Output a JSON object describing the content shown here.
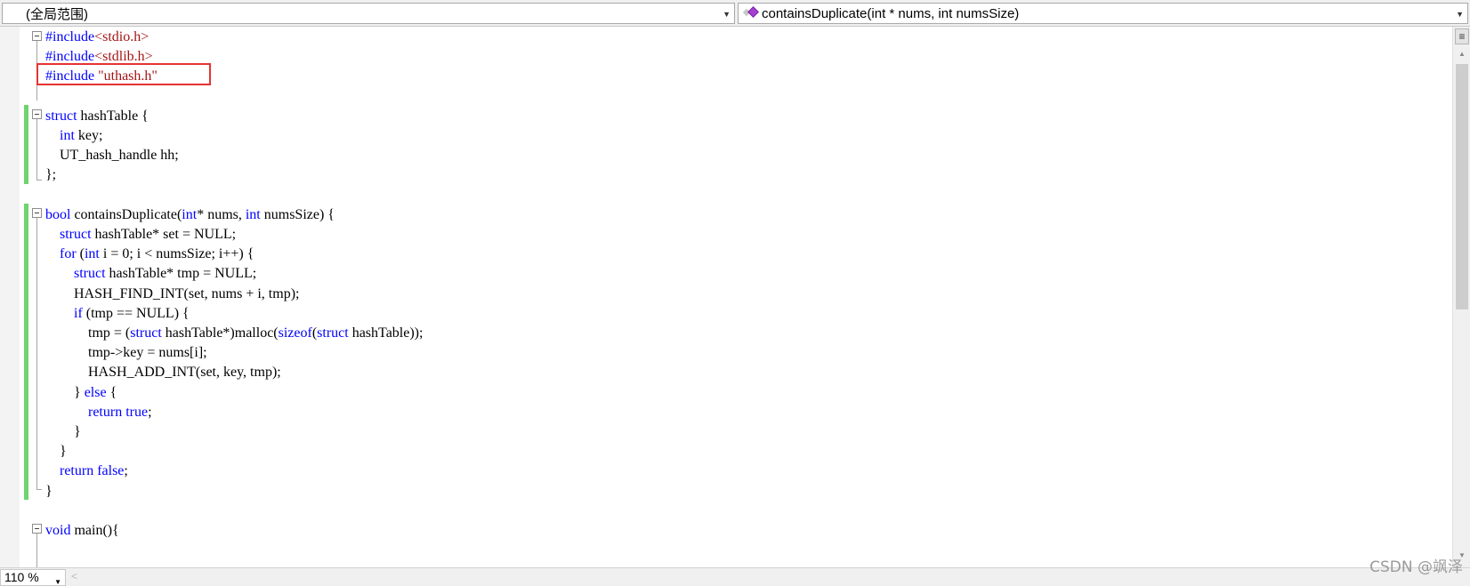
{
  "navbar": {
    "scope_label": "(全局范围)",
    "member_label": "containsDuplicate(int * nums, int numsSize)"
  },
  "code_lines": [
    [
      {
        "t": "#include",
        "c": "kw"
      },
      {
        "t": "<stdio.h>",
        "c": "str"
      }
    ],
    [
      {
        "t": "#include",
        "c": "kw"
      },
      {
        "t": "<stdlib.h>",
        "c": "str"
      }
    ],
    [
      {
        "t": "#include ",
        "c": "kw"
      },
      {
        "t": "\"uthash.h\"",
        "c": "str"
      }
    ],
    [],
    [
      {
        "t": "struct",
        "c": "kw"
      },
      {
        "t": " hashTable {",
        "c": ""
      }
    ],
    [
      {
        "t": "    ",
        "c": ""
      },
      {
        "t": "int",
        "c": "kw"
      },
      {
        "t": " key;",
        "c": ""
      }
    ],
    [
      {
        "t": "    UT_hash_handle hh;",
        "c": ""
      }
    ],
    [
      {
        "t": "};",
        "c": ""
      }
    ],
    [],
    [
      {
        "t": "bool",
        "c": "kw"
      },
      {
        "t": " containsDuplicate(",
        "c": ""
      },
      {
        "t": "int",
        "c": "kw"
      },
      {
        "t": "* nums, ",
        "c": ""
      },
      {
        "t": "int",
        "c": "kw"
      },
      {
        "t": " numsSize) {",
        "c": ""
      }
    ],
    [
      {
        "t": "    ",
        "c": ""
      },
      {
        "t": "struct",
        "c": "kw"
      },
      {
        "t": " hashTable* set = NULL;",
        "c": ""
      }
    ],
    [
      {
        "t": "    ",
        "c": ""
      },
      {
        "t": "for",
        "c": "kw"
      },
      {
        "t": " (",
        "c": ""
      },
      {
        "t": "int",
        "c": "kw"
      },
      {
        "t": " i = 0; i < numsSize; i++) {",
        "c": ""
      }
    ],
    [
      {
        "t": "        ",
        "c": ""
      },
      {
        "t": "struct",
        "c": "kw"
      },
      {
        "t": " hashTable* tmp = NULL;",
        "c": ""
      }
    ],
    [
      {
        "t": "        HASH_FIND_INT(set, nums + i, tmp);",
        "c": ""
      }
    ],
    [
      {
        "t": "        ",
        "c": ""
      },
      {
        "t": "if",
        "c": "kw"
      },
      {
        "t": " (tmp == NULL) {",
        "c": ""
      }
    ],
    [
      {
        "t": "            tmp = (",
        "c": ""
      },
      {
        "t": "struct",
        "c": "kw"
      },
      {
        "t": " hashTable*)malloc(",
        "c": ""
      },
      {
        "t": "sizeof",
        "c": "kw"
      },
      {
        "t": "(",
        "c": ""
      },
      {
        "t": "struct",
        "c": "kw"
      },
      {
        "t": " hashTable));",
        "c": ""
      }
    ],
    [
      {
        "t": "            tmp->key = nums[i];",
        "c": ""
      }
    ],
    [
      {
        "t": "            HASH_ADD_INT(set, key, tmp);",
        "c": ""
      }
    ],
    [
      {
        "t": "        } ",
        "c": ""
      },
      {
        "t": "else",
        "c": "kw"
      },
      {
        "t": " {",
        "c": ""
      }
    ],
    [
      {
        "t": "            ",
        "c": ""
      },
      {
        "t": "return",
        "c": "kw"
      },
      {
        "t": " ",
        "c": ""
      },
      {
        "t": "true",
        "c": "kw"
      },
      {
        "t": ";",
        "c": ""
      }
    ],
    [
      {
        "t": "        }",
        "c": ""
      }
    ],
    [
      {
        "t": "    }",
        "c": ""
      }
    ],
    [
      {
        "t": "    ",
        "c": ""
      },
      {
        "t": "return",
        "c": "kw"
      },
      {
        "t": " ",
        "c": ""
      },
      {
        "t": "false",
        "c": "kw"
      },
      {
        "t": ";",
        "c": ""
      }
    ],
    [
      {
        "t": "}",
        "c": ""
      }
    ],
    [],
    [
      {
        "t": "void",
        "c": "kw"
      },
      {
        "t": " main(){",
        "c": ""
      }
    ]
  ],
  "status": {
    "zoom": "110 %",
    "watermark": "CSDN @飒泽"
  },
  "colors": {
    "keyword": "#0000ff",
    "string": "#a31515",
    "changed_lines": "#6ed46e",
    "highlight_box": "#e53333"
  }
}
